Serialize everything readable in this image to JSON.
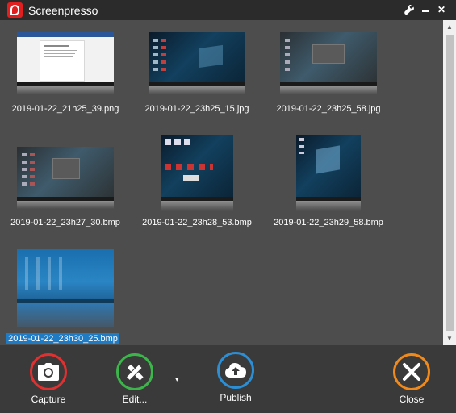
{
  "window": {
    "title": "Screenpresso",
    "settings_icon": "wrench-icon",
    "minimize_label": "▬",
    "close_label": "✕"
  },
  "gallery": {
    "items": [
      {
        "filename": "2019-01-22_21h25_39.png",
        "kind": "document"
      },
      {
        "filename": "2019-01-22_23h25_15.jpg",
        "kind": "desktop-dark"
      },
      {
        "filename": "2019-01-22_23h25_58.jpg",
        "kind": "desktop-dim"
      },
      {
        "filename": "2019-01-22_23h27_30.bmp",
        "kind": "desktop-dim"
      },
      {
        "filename": "2019-01-22_23h28_53.bmp",
        "kind": "desktop-icons"
      },
      {
        "filename": "2019-01-22_23h29_58.bmp",
        "kind": "desktop-windows"
      },
      {
        "filename": "2019-01-22_23h30_25.bmp",
        "kind": "desktop-blue",
        "selected": true
      }
    ]
  },
  "toolbar": {
    "capture_label": "Capture",
    "edit_label": "Edit...",
    "dropdown_label": "▾",
    "publish_label": "Publish",
    "close_label": "Close",
    "colors": {
      "capture": "#e03030",
      "edit": "#3cb54a",
      "publish": "#2c8fd6",
      "close": "#f08a1c"
    }
  }
}
